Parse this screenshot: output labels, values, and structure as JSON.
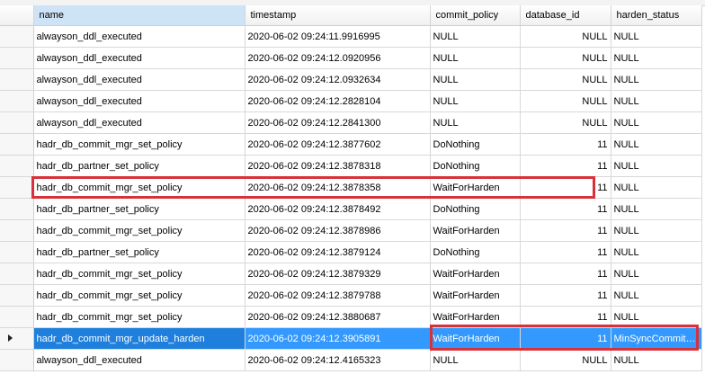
{
  "columns": [
    "name",
    "timestamp",
    "commit_policy",
    "database_id",
    "harden_status"
  ],
  "selected_column_index": 0,
  "selected_row_index": 14,
  "rows": [
    {
      "name": "alwayson_ddl_executed",
      "timestamp": "2020-06-02 09:24:11.9916995",
      "commit_policy": "NULL",
      "database_id": "NULL",
      "harden_status": "NULL"
    },
    {
      "name": "alwayson_ddl_executed",
      "timestamp": "2020-06-02 09:24:12.0920956",
      "commit_policy": "NULL",
      "database_id": "NULL",
      "harden_status": "NULL"
    },
    {
      "name": "alwayson_ddl_executed",
      "timestamp": "2020-06-02 09:24:12.0932634",
      "commit_policy": "NULL",
      "database_id": "NULL",
      "harden_status": "NULL"
    },
    {
      "name": "alwayson_ddl_executed",
      "timestamp": "2020-06-02 09:24:12.2828104",
      "commit_policy": "NULL",
      "database_id": "NULL",
      "harden_status": "NULL"
    },
    {
      "name": "alwayson_ddl_executed",
      "timestamp": "2020-06-02 09:24:12.2841300",
      "commit_policy": "NULL",
      "database_id": "NULL",
      "harden_status": "NULL"
    },
    {
      "name": "hadr_db_commit_mgr_set_policy",
      "timestamp": "2020-06-02 09:24:12.3877602",
      "commit_policy": "DoNothing",
      "database_id": "11",
      "harden_status": "NULL"
    },
    {
      "name": "hadr_db_partner_set_policy",
      "timestamp": "2020-06-02 09:24:12.3878318",
      "commit_policy": "DoNothing",
      "database_id": "11",
      "harden_status": "NULL"
    },
    {
      "name": "hadr_db_commit_mgr_set_policy",
      "timestamp": "2020-06-02 09:24:12.3878358",
      "commit_policy": "WaitForHarden",
      "database_id": "11",
      "harden_status": "NULL"
    },
    {
      "name": "hadr_db_partner_set_policy",
      "timestamp": "2020-06-02 09:24:12.3878492",
      "commit_policy": "DoNothing",
      "database_id": "11",
      "harden_status": "NULL"
    },
    {
      "name": "hadr_db_commit_mgr_set_policy",
      "timestamp": "2020-06-02 09:24:12.3878986",
      "commit_policy": "WaitForHarden",
      "database_id": "11",
      "harden_status": "NULL"
    },
    {
      "name": "hadr_db_partner_set_policy",
      "timestamp": "2020-06-02 09:24:12.3879124",
      "commit_policy": "DoNothing",
      "database_id": "11",
      "harden_status": "NULL"
    },
    {
      "name": "hadr_db_commit_mgr_set_policy",
      "timestamp": "2020-06-02 09:24:12.3879329",
      "commit_policy": "WaitForHarden",
      "database_id": "11",
      "harden_status": "NULL"
    },
    {
      "name": "hadr_db_commit_mgr_set_policy",
      "timestamp": "2020-06-02 09:24:12.3879788",
      "commit_policy": "WaitForHarden",
      "database_id": "11",
      "harden_status": "NULL"
    },
    {
      "name": "hadr_db_commit_mgr_set_policy",
      "timestamp": "2020-06-02 09:24:12.3880687",
      "commit_policy": "WaitForHarden",
      "database_id": "11",
      "harden_status": "NULL"
    },
    {
      "name": "hadr_db_commit_mgr_update_harden",
      "timestamp": "2020-06-02 09:24:12.3905891",
      "commit_policy": "WaitForHarden",
      "database_id": "11",
      "harden_status": "MinSyncCommitF..."
    },
    {
      "name": "alwayson_ddl_executed",
      "timestamp": "2020-06-02 09:24:12.4165323",
      "commit_policy": "NULL",
      "database_id": "NULL",
      "harden_status": "NULL"
    }
  ],
  "colors": {
    "selection": "#3399ff",
    "highlight_border": "#d7323a",
    "header_selected": "#cfe3f7"
  }
}
